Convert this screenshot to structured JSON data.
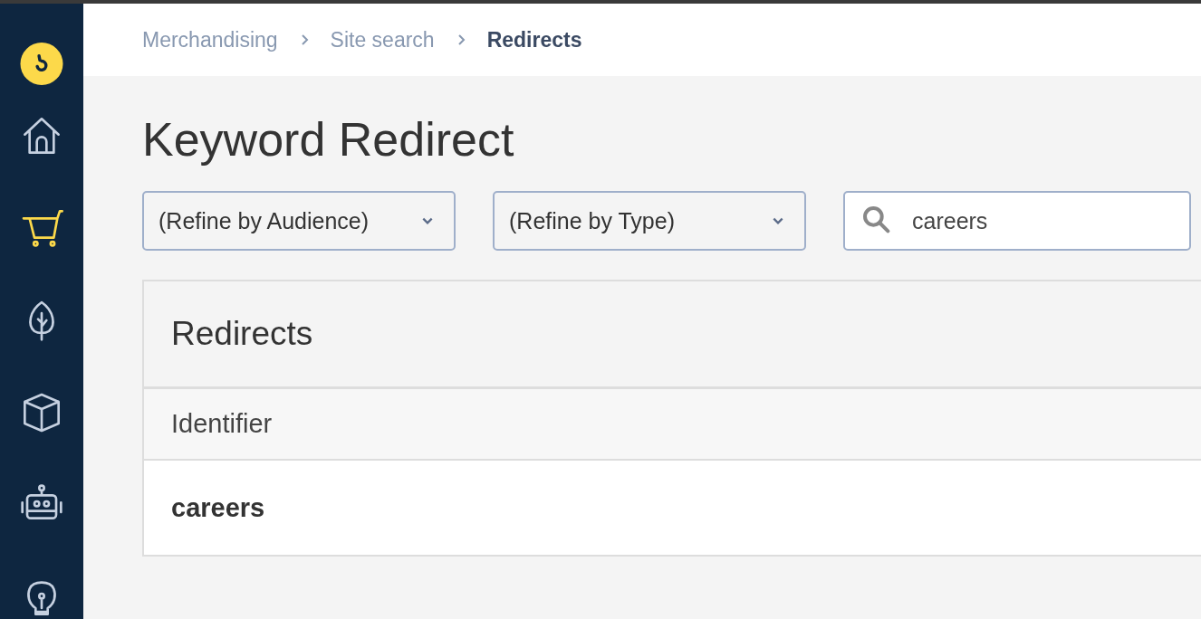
{
  "sidebar": {
    "items": [
      {
        "kind": "home",
        "selected": false
      },
      {
        "kind": "cart",
        "selected": true
      },
      {
        "kind": "leaf",
        "selected": false
      },
      {
        "kind": "cube",
        "selected": false
      },
      {
        "kind": "robot",
        "selected": false
      },
      {
        "kind": "bulb",
        "selected": false
      }
    ]
  },
  "breadcrumb": [
    "Merchandising",
    "Site search",
    "Redirects"
  ],
  "title": "Keyword Redirect",
  "filters": [
    {
      "label": "(Refine by Audience)"
    },
    {
      "label": "(Refine by Type)"
    }
  ],
  "search": {
    "value": "careers"
  },
  "table": {
    "title": "Redirects",
    "columns": [
      "Identifier"
    ],
    "rows": [
      [
        "careers"
      ]
    ]
  }
}
